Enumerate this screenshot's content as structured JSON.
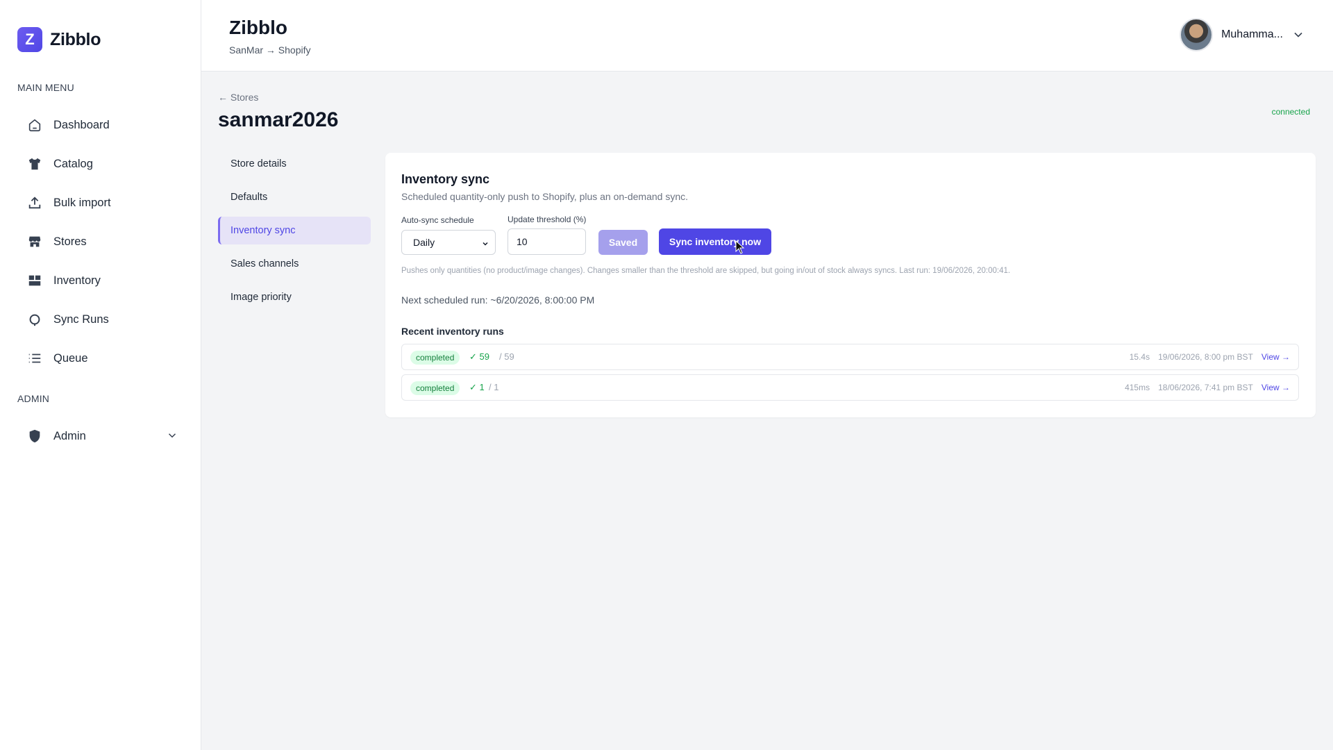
{
  "brand": {
    "logo_letter": "Z",
    "name": "Zibblo"
  },
  "sidebar": {
    "main_menu_label": "MAIN MENU",
    "items": [
      {
        "label": "Dashboard",
        "icon": "home-icon"
      },
      {
        "label": "Catalog",
        "icon": "shirt-icon"
      },
      {
        "label": "Bulk import",
        "icon": "upload-icon"
      },
      {
        "label": "Stores",
        "icon": "store-icon"
      },
      {
        "label": "Inventory",
        "icon": "grid-icon"
      },
      {
        "label": "Sync Runs",
        "icon": "refresh-icon"
      },
      {
        "label": "Queue",
        "icon": "list-icon"
      }
    ],
    "admin_label": "ADMIN",
    "admin_item": "Admin"
  },
  "header": {
    "title": "Zibblo",
    "subtitle": "SanMar → Shopify",
    "user_name": "Muhamma..."
  },
  "page": {
    "back_link": "← Stores",
    "title": "sanmar2026",
    "status": "connected"
  },
  "subnav": {
    "items": [
      "Store details",
      "Defaults",
      "Inventory sync",
      "Sales channels",
      "Image priority"
    ],
    "active_index": 2
  },
  "card": {
    "title": "Inventory sync",
    "description": "Scheduled quantity-only push to Shopify, plus an on-demand sync.",
    "schedule_label": "Auto-sync schedule",
    "schedule_value": "Daily",
    "threshold_label": "Update threshold (%)",
    "threshold_value": "10",
    "saved_button": "Saved",
    "sync_button": "Sync inventory now",
    "help_text": "Pushes only quantities (no product/image changes). Changes smaller than the threshold are skipped, but going in/out of stock always syncs. Last run: 19/06/2026, 20:00:41.",
    "next_run": "Next scheduled run: ~6/20/2026, 8:00:00 PM",
    "runs_heading": "Recent inventory runs",
    "runs": [
      {
        "status": "completed",
        "ok": "✓ 59",
        "total": "/ 59",
        "duration": "15.4s",
        "timestamp": "19/06/2026, 8:00 pm BST",
        "view": "View →"
      },
      {
        "status": "completed",
        "ok": "✓ 1",
        "total": "/ 1",
        "duration": "415ms",
        "timestamp": "18/06/2026, 7:41 pm BST",
        "view": "View →"
      }
    ]
  },
  "colors": {
    "accent": "#4f46e5",
    "success": "#16a34a"
  }
}
